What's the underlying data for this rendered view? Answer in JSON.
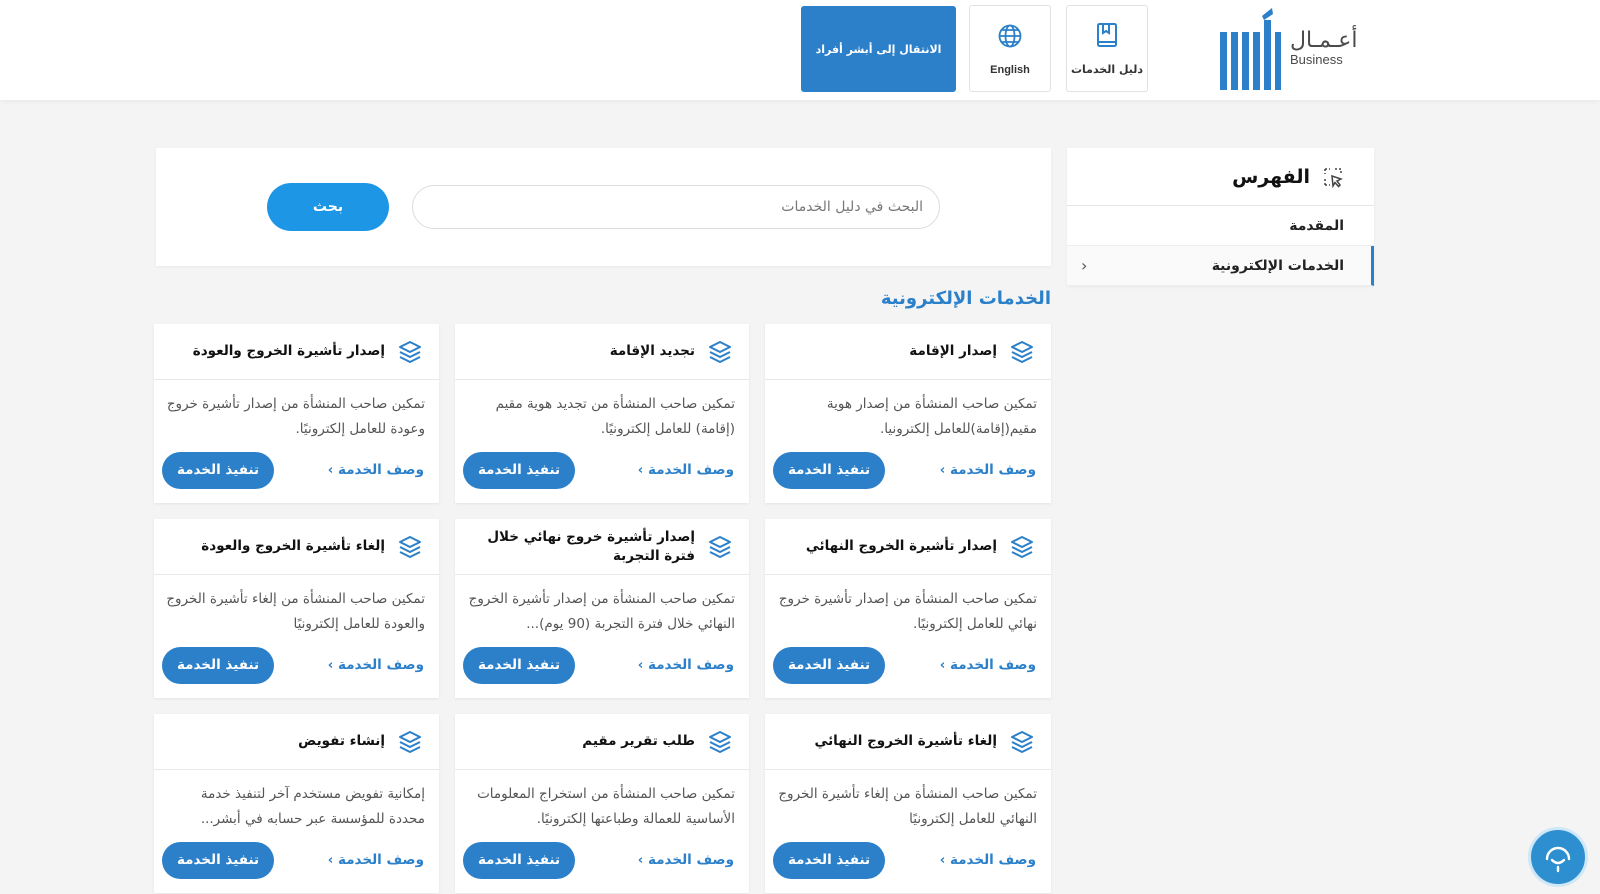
{
  "header": {
    "logo_ar": "أعـمـال",
    "logo_en": "Business",
    "guide_label": "دليل الخدمات",
    "lang_label": "English",
    "absher_label": "الانتقال إلى أبشر أفراد"
  },
  "sidebar": {
    "title": "الفهرس",
    "items": [
      {
        "label": "المقدمة"
      },
      {
        "label": "الخدمات الإلكترونية"
      }
    ]
  },
  "search": {
    "placeholder": "البحث في دليل الخدمات",
    "button_label": "بحث"
  },
  "section": {
    "title": "الخدمات الإلكترونية"
  },
  "cards": [
    {
      "title": "إصدار الإقامة",
      "desc": "تمكين صاحب المنشأة من إصدار هوية مقيم(إقامة)للعامل إلكترونيا.",
      "link": "وصف الخدمة ›",
      "button": "تنفيذ الخدمة"
    },
    {
      "title": "تجديد الإقامة",
      "desc": "تمكين صاحب المنشأة من تجديد هوية مقيم (إقامة) للعامل إلكترونيًا.",
      "link": "وصف الخدمة ›",
      "button": "تنفيذ الخدمة"
    },
    {
      "title": "إصدار تأشيرة الخروج والعودة",
      "desc": "تمكين صاحب المنشأة من إصدار تأشيرة خروج وعودة للعامل إلكترونيًا.",
      "link": "وصف الخدمة ›",
      "button": "تنفيذ الخدمة"
    },
    {
      "title": "إصدار تأشيرة الخروج النهائي",
      "desc": "تمكين صاحب المنشأة من إصدار تأشيرة خروج نهائي للعامل إلكترونيًا.",
      "link": "وصف الخدمة ›",
      "button": "تنفيذ الخدمة"
    },
    {
      "title": "إصدار تأشيرة خروج نهائي خلال فترة التجربة",
      "desc": "تمكين صاحب المنشأة من إصدار تأشيرة الخروج النهائي خلال فترة التجربة (90 يوم)...",
      "link": "وصف الخدمة ›",
      "button": "تنفيذ الخدمة"
    },
    {
      "title": "إلغاء تأشيرة الخروج والعودة",
      "desc": "تمكين صاحب المنشأة من إلغاء تأشيرة الخروج والعودة للعامل إلكترونيًا",
      "link": "وصف الخدمة ›",
      "button": "تنفيذ الخدمة"
    },
    {
      "title": "إلغاء تأشيرة الخروج النهائي",
      "desc": "تمكين صاحب المنشأة من إلغاء تأشيرة الخروج النهائي للعامل إلكترونيًا",
      "link": "وصف الخدمة ›",
      "button": "تنفيذ الخدمة"
    },
    {
      "title": "طلب تقرير مقيم",
      "desc": "تمكين صاحب المنشأة من استخراج المعلومات الأساسية للعمالة وطباعتها إلكترونيًا.",
      "link": "وصف الخدمة ›",
      "button": "تنفيذ الخدمة"
    },
    {
      "title": "إنشاء تفويض",
      "desc": "إمكانية تفويض مستخدم آخر لتنفيذ خدمة محددة للمؤسسة عبر حسابه في أبشر...",
      "link": "وصف الخدمة ›",
      "button": "تنفيذ الخدمة"
    }
  ],
  "colors": {
    "primary": "#2b80c9",
    "search_button": "#1e96e6",
    "background": "#f4f4f4"
  }
}
